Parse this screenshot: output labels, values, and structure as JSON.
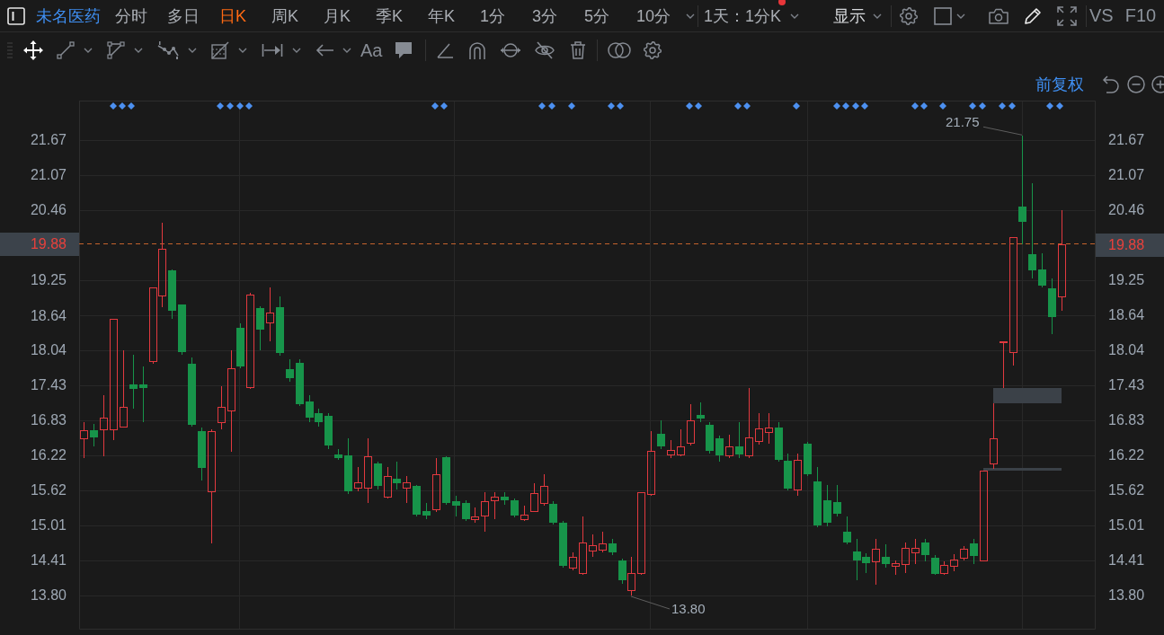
{
  "top_bar": {
    "stock_name": "未名医药",
    "periods": [
      {
        "label": "分时",
        "selected": false
      },
      {
        "label": "多日",
        "selected": false
      },
      {
        "label": "日K",
        "selected": true
      },
      {
        "label": "周K",
        "selected": false
      },
      {
        "label": "月K",
        "selected": false
      },
      {
        "label": "季K",
        "selected": false
      },
      {
        "label": "年K",
        "selected": false
      },
      {
        "label": "1分",
        "selected": false
      },
      {
        "label": "3分",
        "selected": false
      },
      {
        "label": "5分",
        "selected": false
      },
      {
        "label": "10分",
        "selected": false
      }
    ],
    "interval_menu": {
      "label": "1天：1分K",
      "badge": true
    },
    "display_menu": "显示",
    "links": [
      "VS",
      "F10"
    ]
  },
  "drawing_toolbar": {
    "text_tool": "Aa"
  },
  "chart": {
    "adjustment": "前复权",
    "chart_data": {
      "type": "candlestick",
      "ylim": [
        13.21,
        22.36
      ],
      "grid": true,
      "yticks": [
        {
          "value": 21.67,
          "label": "21.67"
        },
        {
          "value": 21.07,
          "label": "21.07"
        },
        {
          "value": 20.46,
          "label": "20.46"
        },
        {
          "value": 19.25,
          "label": "19.25"
        },
        {
          "value": 18.64,
          "label": "18.64"
        },
        {
          "value": 18.04,
          "label": "18.04"
        },
        {
          "value": 17.43,
          "label": "17.43"
        },
        {
          "value": 16.83,
          "label": "16.83"
        },
        {
          "value": 16.22,
          "label": "16.22"
        },
        {
          "value": 15.62,
          "label": "15.62"
        },
        {
          "value": 15.01,
          "label": "15.01"
        },
        {
          "value": 14.41,
          "label": "14.41"
        },
        {
          "value": 13.8,
          "label": "13.80"
        }
      ],
      "ref_lines": [
        {
          "axis": "y",
          "value": 19.88,
          "label": "19.88"
        }
      ],
      "bands": [
        {
          "axis": "y",
          "from": 17.12,
          "to": 17.39
        },
        {
          "axis": "y",
          "from": 15.96,
          "to": 16.0
        }
      ],
      "categories": [
        null,
        null,
        null,
        null,
        null,
        null,
        null,
        null,
        null,
        null,
        null,
        null,
        null,
        null,
        null,
        null,
        null,
        null,
        null,
        null,
        null,
        null,
        null,
        null,
        null,
        null,
        null,
        null,
        null,
        null,
        null,
        null,
        null,
        null,
        null,
        null,
        null,
        null,
        null,
        null,
        null,
        null,
        null,
        null,
        null,
        null,
        null,
        null,
        null,
        null,
        null,
        null,
        null,
        null,
        null,
        null,
        null,
        null,
        null,
        null,
        null,
        null,
        null,
        null,
        null,
        null,
        null,
        null,
        null,
        null,
        null,
        null,
        null,
        null,
        null,
        null,
        null,
        null,
        null,
        null,
        null,
        null,
        null,
        null,
        null,
        null,
        null,
        null,
        null,
        null,
        null,
        null,
        null,
        null,
        null,
        null,
        null,
        null,
        null,
        null,
        null,
        null,
        null,
        null
      ],
      "ohlc": [
        [
          16.52,
          16.8,
          16.18,
          16.66
        ],
        [
          16.66,
          16.77,
          16.38,
          16.53
        ],
        [
          16.67,
          17.26,
          16.21,
          16.87
        ],
        [
          16.67,
          18.58,
          16.49,
          18.58
        ],
        [
          16.72,
          18.04,
          16.72,
          17.06
        ],
        [
          17.45,
          17.96,
          17.03,
          17.37
        ],
        [
          17.45,
          17.76,
          16.8,
          17.39
        ],
        [
          17.85,
          19.13,
          17.81,
          19.13
        ],
        [
          18.99,
          20.24,
          18.78,
          19.79
        ],
        [
          19.42,
          19.44,
          18.58,
          18.72
        ],
        [
          18.83,
          18.83,
          17.96,
          18.01
        ],
        [
          17.81,
          17.92,
          16.72,
          16.75
        ],
        [
          16.64,
          16.7,
          15.79,
          16.0
        ],
        [
          15.6,
          16.67,
          14.7,
          16.64
        ],
        [
          16.8,
          17.42,
          16.67,
          17.06
        ],
        [
          17.0,
          18.04,
          16.28,
          17.73
        ],
        [
          18.43,
          18.5,
          17.73,
          17.76
        ],
        [
          17.4,
          19.03,
          17.37,
          19.0
        ],
        [
          18.77,
          18.81,
          18.04,
          18.4
        ],
        [
          18.52,
          19.13,
          18.19,
          18.69
        ],
        [
          18.78,
          18.97,
          17.95,
          17.99
        ],
        [
          17.71,
          17.88,
          17.5,
          17.56
        ],
        [
          17.82,
          17.88,
          17.08,
          17.11
        ],
        [
          17.15,
          17.26,
          16.8,
          16.87
        ],
        [
          16.95,
          17.03,
          16.72,
          16.8
        ],
        [
          16.9,
          16.95,
          16.33,
          16.39
        ],
        [
          16.24,
          16.33,
          16.14,
          16.18
        ],
        [
          16.22,
          16.52,
          15.56,
          15.6
        ],
        [
          15.66,
          16.02,
          15.6,
          15.76
        ],
        [
          15.66,
          16.52,
          15.4,
          16.21
        ],
        [
          16.08,
          16.11,
          15.63,
          15.69
        ],
        [
          15.51,
          16.02,
          15.48,
          15.87
        ],
        [
          15.82,
          16.11,
          15.63,
          15.74
        ],
        [
          15.66,
          15.87,
          15.4,
          15.76
        ],
        [
          15.69,
          15.71,
          15.17,
          15.2
        ],
        [
          15.26,
          15.4,
          15.12,
          15.18
        ],
        [
          15.29,
          16.18,
          15.24,
          15.9
        ],
        [
          16.19,
          16.21,
          15.37,
          15.4
        ],
        [
          15.43,
          15.52,
          15.17,
          15.35
        ],
        [
          15.4,
          15.45,
          15.09,
          15.12
        ],
        [
          15.12,
          15.32,
          15.06,
          15.17
        ],
        [
          15.18,
          15.58,
          14.9,
          15.43
        ],
        [
          15.45,
          15.58,
          15.12,
          15.51
        ],
        [
          15.51,
          15.58,
          15.37,
          15.45
        ],
        [
          15.45,
          15.48,
          15.15,
          15.18
        ],
        [
          15.12,
          15.35,
          15.09,
          15.2
        ],
        [
          15.26,
          15.74,
          15.24,
          15.57
        ],
        [
          15.4,
          15.9,
          15.35,
          15.69
        ],
        [
          15.38,
          15.43,
          15.03,
          15.06
        ],
        [
          15.06,
          15.09,
          14.28,
          14.31
        ],
        [
          14.28,
          14.55,
          14.23,
          14.47
        ],
        [
          14.19,
          15.17,
          14.16,
          14.72
        ],
        [
          14.58,
          14.86,
          14.47,
          14.67
        ],
        [
          14.59,
          14.9,
          14.55,
          14.7
        ],
        [
          14.7,
          14.78,
          14.5,
          14.55
        ],
        [
          14.41,
          14.44,
          14.0,
          14.06
        ],
        [
          13.89,
          14.47,
          13.8,
          14.19
        ],
        [
          14.19,
          15.58,
          14.16,
          15.58
        ],
        [
          15.56,
          16.64,
          15.52,
          16.3
        ],
        [
          16.59,
          16.83,
          16.33,
          16.38
        ],
        [
          16.24,
          16.49,
          16.18,
          16.32
        ],
        [
          16.24,
          16.67,
          16.21,
          16.38
        ],
        [
          16.44,
          17.11,
          16.39,
          16.83
        ],
        [
          16.92,
          17.14,
          16.8,
          16.86
        ],
        [
          16.75,
          16.8,
          16.25,
          16.3
        ],
        [
          16.52,
          16.56,
          16.11,
          16.22
        ],
        [
          16.22,
          16.58,
          16.18,
          16.38
        ],
        [
          16.38,
          16.8,
          16.18,
          16.24
        ],
        [
          16.22,
          17.39,
          16.18,
          16.53
        ],
        [
          16.47,
          16.95,
          16.41,
          16.69
        ],
        [
          16.63,
          16.95,
          16.42,
          16.7
        ],
        [
          16.7,
          16.8,
          16.11,
          16.14
        ],
        [
          16.13,
          16.25,
          15.62,
          15.65
        ],
        [
          15.63,
          16.25,
          15.52,
          16.14
        ],
        [
          16.42,
          16.45,
          15.87,
          15.9
        ],
        [
          15.77,
          16.02,
          14.98,
          15.01
        ],
        [
          15.45,
          15.71,
          15.0,
          15.06
        ],
        [
          15.41,
          15.71,
          15.17,
          15.21
        ],
        [
          14.9,
          15.17,
          14.68,
          14.72
        ],
        [
          14.56,
          14.78,
          14.06,
          14.41
        ],
        [
          14.47,
          14.53,
          14.19,
          14.36
        ],
        [
          14.39,
          14.78,
          13.99,
          14.61
        ],
        [
          14.47,
          14.68,
          14.28,
          14.34
        ],
        [
          14.31,
          14.41,
          14.16,
          14.36
        ],
        [
          14.34,
          14.72,
          14.19,
          14.62
        ],
        [
          14.55,
          14.78,
          14.34,
          14.62
        ],
        [
          14.72,
          14.78,
          14.39,
          14.5
        ],
        [
          14.45,
          14.5,
          14.16,
          14.17
        ],
        [
          14.19,
          14.39,
          14.16,
          14.33
        ],
        [
          14.31,
          14.51,
          14.22,
          14.42
        ],
        [
          14.45,
          14.65,
          14.41,
          14.61
        ],
        [
          14.7,
          14.78,
          14.34,
          14.48
        ],
        [
          14.41,
          15.96,
          14.41,
          15.96
        ],
        [
          16.08,
          17.12,
          15.99,
          16.52
        ],
        [
          18.18,
          18.19,
          17.39,
          18.19
        ],
        [
          18.01,
          20.0,
          17.77,
          20.0
        ],
        [
          20.52,
          21.75,
          19.87,
          20.27
        ],
        [
          19.7,
          20.93,
          19.28,
          19.42
        ],
        [
          19.44,
          19.72,
          19.13,
          19.16
        ],
        [
          19.11,
          19.28,
          18.32,
          18.61
        ],
        [
          18.97,
          20.46,
          18.72,
          19.88
        ],
        null,
        null,
        null
      ]
    },
    "annotations": [
      {
        "kind": "high",
        "label": "21.75"
      },
      {
        "kind": "low",
        "label": "13.80"
      }
    ],
    "y_axis_right": [
      {
        "kind": "tick",
        "label": "21.67"
      },
      {
        "kind": "tick",
        "label": "21.07"
      },
      {
        "kind": "tick",
        "label": "20.46"
      },
      {
        "kind": "current",
        "label": "19.88"
      },
      {
        "kind": "tick",
        "label": "19.25"
      },
      {
        "kind": "tick",
        "label": "18.64"
      },
      {
        "kind": "tick",
        "label": "18.04"
      },
      {
        "kind": "tick",
        "label": "17.43"
      },
      {
        "kind": "tick",
        "label": "16.83"
      },
      {
        "kind": "tick",
        "label": "16.22"
      },
      {
        "kind": "tick",
        "label": "15.62"
      },
      {
        "kind": "tick",
        "label": "15.01"
      },
      {
        "kind": "tick",
        "label": "14.41"
      },
      {
        "kind": "tick",
        "label": "13.80"
      }
    ]
  }
}
